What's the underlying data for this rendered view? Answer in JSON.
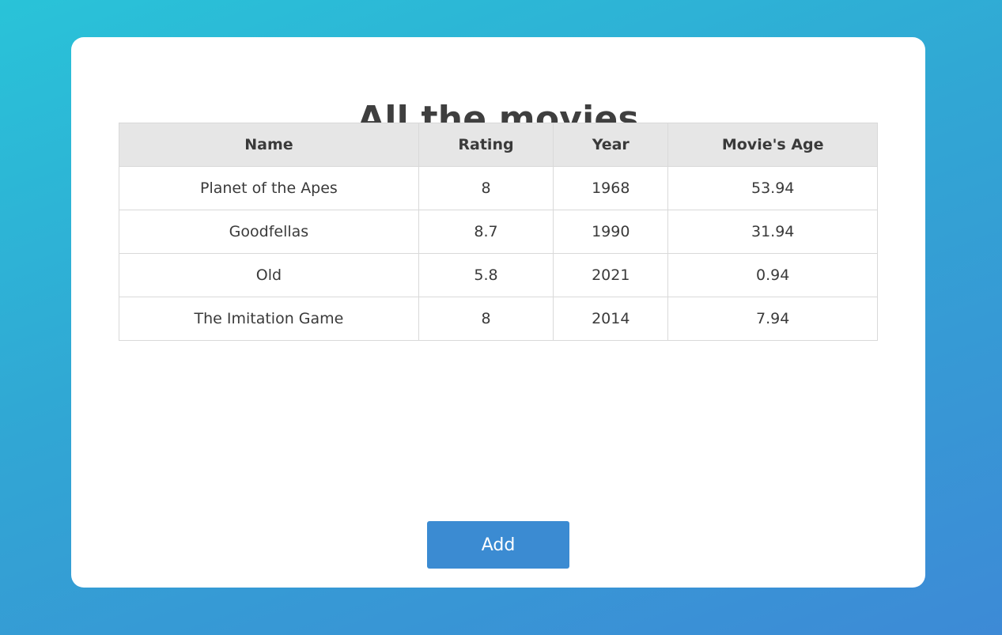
{
  "page": {
    "title": "All the movies"
  },
  "table": {
    "headers": [
      "Name",
      "Rating",
      "Year",
      "Movie's Age"
    ],
    "rows": [
      [
        "Planet of the Apes",
        "8",
        "1968",
        "53.94"
      ],
      [
        "Goodfellas",
        "8.7",
        "1990",
        "31.94"
      ],
      [
        "Old",
        "5.8",
        "2021",
        "0.94"
      ],
      [
        "The Imitation Game",
        "8",
        "2014",
        "7.94"
      ]
    ]
  },
  "actions": {
    "add_label": "Add"
  },
  "colors": {
    "background_top": "#29c3d8",
    "background_bottom": "#3d8ad6",
    "header_bg": "#e6e6e6",
    "button_bg": "#3b8bd2",
    "text": "#3a3a3a"
  }
}
